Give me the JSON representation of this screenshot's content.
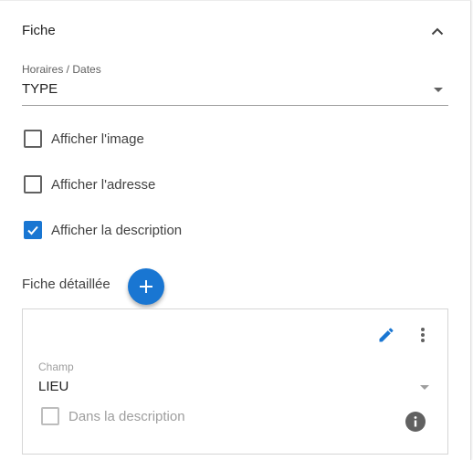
{
  "header": {
    "title": "Fiche",
    "collapse_icon": "chevron-up-icon"
  },
  "type_select": {
    "label": "Horaires / Dates",
    "value": "TYPE"
  },
  "options": [
    {
      "label": "Afficher l'image",
      "checked": false
    },
    {
      "label": "Afficher l'adresse",
      "checked": false
    },
    {
      "label": "Afficher la description",
      "checked": true
    }
  ],
  "detailed": {
    "title": "Fiche détaillée",
    "add_icon": "plus-icon",
    "card": {
      "edit_icon": "pencil-icon",
      "more_icon": "more-vert-icon",
      "field_label": "Champ",
      "field_value": "LIEU",
      "checkbox_label": "Dans la description",
      "checkbox_checked": false,
      "info_icon": "info-icon"
    }
  },
  "colors": {
    "accent": "#1976d2"
  }
}
